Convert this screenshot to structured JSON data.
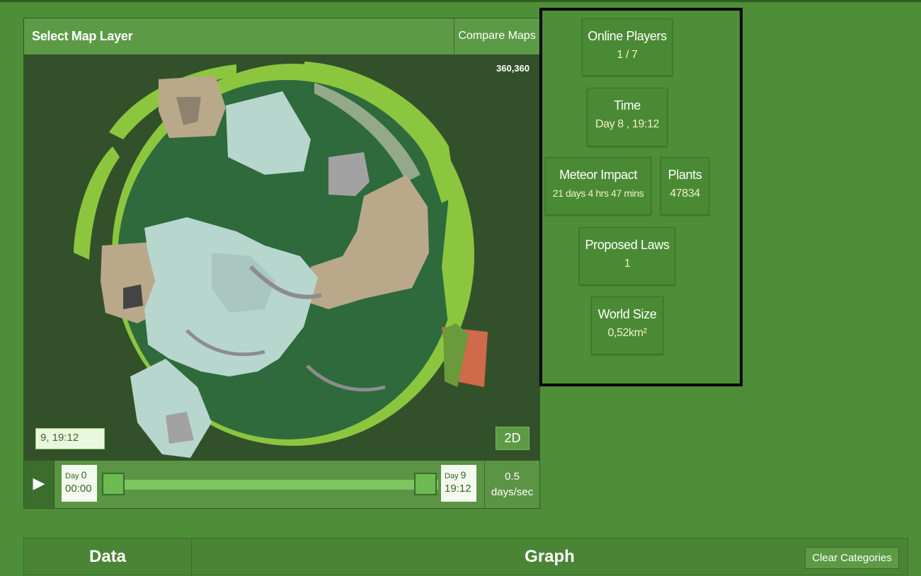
{
  "map": {
    "title": "Select Map Layer",
    "compare_label": "Compare Maps",
    "coordinates": "360,360",
    "time_value": "9, 19:12",
    "view_toggle_label": "2D"
  },
  "timeline": {
    "play_icon": "▶",
    "start": {
      "day_label": "Day",
      "day_number": "0",
      "time": "00:00"
    },
    "end": {
      "day_label": "Day",
      "day_number": "9",
      "time": "19:12"
    },
    "speed_value": "0.5",
    "speed_unit": "days/sec"
  },
  "stats": {
    "online_players": {
      "label": "Online Players",
      "value": "1 / 7"
    },
    "time": {
      "label": "Time",
      "value": "Day 8 , 19:12"
    },
    "meteor": {
      "label": "Meteor Impact",
      "value": "21 days 4 hrs 47 mins"
    },
    "plants": {
      "label": "Plants",
      "value": "47834"
    },
    "laws": {
      "label": "Proposed Laws",
      "value": "1"
    },
    "world_size": {
      "label": "World Size",
      "value": "0,52km²"
    }
  },
  "bottom": {
    "data_tab": "Data",
    "graph_title": "Graph",
    "clear_label": "Clear Categories"
  },
  "colors": {
    "page_bg": "#4f8e38",
    "forest": "#2f6a3c",
    "grass": "#8cc63f",
    "snow": "#b7d6ce",
    "sand": "#b9a98a",
    "rock": "#9a9a9a"
  }
}
